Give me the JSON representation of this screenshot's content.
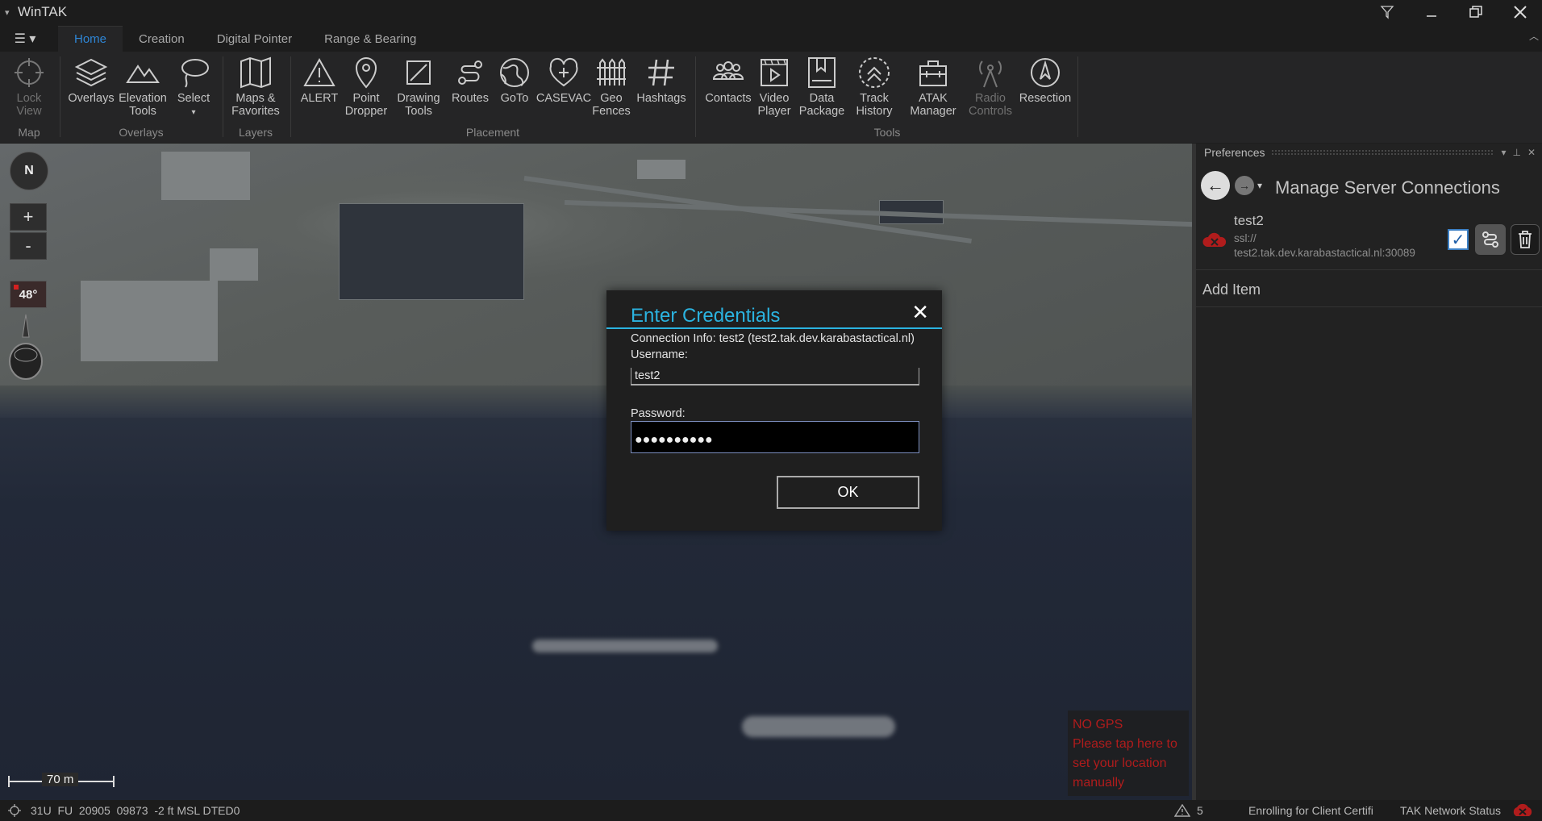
{
  "app": {
    "title": "WinTAK"
  },
  "window_buttons": [
    "filter-icon",
    "minimize",
    "restore",
    "close"
  ],
  "tabs": [
    {
      "label": "Home",
      "active": true
    },
    {
      "label": "Creation"
    },
    {
      "label": "Digital Pointer"
    },
    {
      "label": "Range & Bearing"
    }
  ],
  "ribbon": {
    "lock_view": "Lock\nView",
    "overlays": "Overlays",
    "elevation_tools": "Elevation\nTools",
    "select": "Select",
    "maps_favorites": "Maps &\nFavorites",
    "alert": "ALERT",
    "point_dropper": "Point\nDropper",
    "drawing_tools": "Drawing\nTools",
    "routes": "Routes",
    "goto": "GoTo",
    "casevac": "CASEVAC",
    "geo_fences": "Geo\nFences",
    "hashtags": "Hashtags",
    "contacts": "Contacts",
    "video_player": "Video\nPlayer",
    "data_package": "Data\nPackage",
    "track_history": "Track\nHistory",
    "atak_manager": "ATAK\nManager",
    "radio_controls": "Radio\nControls",
    "resection": "Resection",
    "groups": {
      "map": "Map",
      "overlays": "Overlays",
      "layers": "Layers",
      "placement": "Placement",
      "tools": "Tools"
    }
  },
  "map": {
    "compass": "N",
    "zoom_in": "+",
    "zoom_out": "-",
    "tilt": "48°",
    "scale": "70 m",
    "no_gps": "NO GPS\nPlease tap here to set your location manually"
  },
  "dialog": {
    "title": "Enter Credentials",
    "info": "Connection Info: test2 (test2.tak.dev.karabastactical.nl)",
    "username_label": "Username:",
    "username_value": "test2",
    "password_label": "Password:",
    "password_mask": "●●●●●●●●●●",
    "ok": "OK",
    "close": "✕"
  },
  "preferences": {
    "header": "Preferences",
    "title": "Manage Server Connections",
    "server": {
      "name": "test2",
      "protocol": "ssl://",
      "host": "test2.tak.dev.karabastactical.nl:30089",
      "enabled": true
    },
    "add_item": "Add Item"
  },
  "status": {
    "coords": "31U  FU  20905  09873  -2 ft MSL DTED0",
    "warnings": "5",
    "enroll": "Enrolling for Client Certifi",
    "network": "TAK Network Status"
  },
  "colors": {
    "accent_blue": "#2bb3e0",
    "tab_active": "#2e86d6",
    "alert_red": "#b01c1c"
  }
}
